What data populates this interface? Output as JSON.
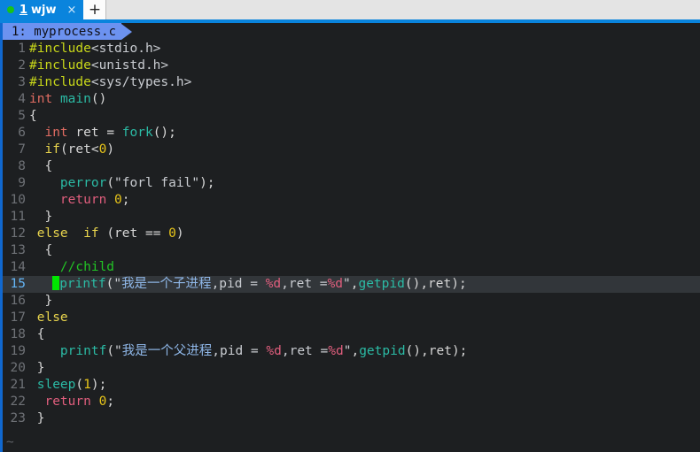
{
  "tabbar": {
    "tab": {
      "status_dot": "green-dot-icon",
      "number": "1",
      "title": "wjw",
      "close_glyph": "×"
    },
    "new_tab_glyph": "+",
    "colors": {
      "active_tab_bg": "#0a84dd",
      "bar_bg": "#e4e4e4",
      "dot": "#19c319"
    }
  },
  "winbar": {
    "crumb": "1: myprocess.c",
    "crumb_bg": "#6c92f0"
  },
  "editor": {
    "filename": "myprocess.c",
    "background": "#1d1f21",
    "current_line": 15,
    "cursor_color": "#00e600",
    "current_line_bg": "#32363a",
    "empty_marker": "~",
    "lines": [
      {
        "n": "1",
        "tokens": [
          {
            "t": "#include",
            "c": "t-pre"
          },
          {
            "t": "<stdio.h>",
            "c": "t-hdr"
          }
        ]
      },
      {
        "n": "2",
        "tokens": [
          {
            "t": "#include",
            "c": "t-pre"
          },
          {
            "t": "<unistd.h>",
            "c": "t-hdr"
          }
        ]
      },
      {
        "n": "3",
        "tokens": [
          {
            "t": "#include",
            "c": "t-pre"
          },
          {
            "t": "<sys/types.h>",
            "c": "t-hdr"
          }
        ]
      },
      {
        "n": "4",
        "tokens": [
          {
            "t": "int",
            "c": "t-type"
          },
          {
            "t": " ",
            "c": "t-plain"
          },
          {
            "t": "main",
            "c": "t-fn"
          },
          {
            "t": "()",
            "c": "t-plain"
          }
        ]
      },
      {
        "n": "5",
        "tokens": [
          {
            "t": "{",
            "c": "t-plain"
          }
        ]
      },
      {
        "n": "6",
        "tokens": [
          {
            "t": "  ",
            "c": "t-plain"
          },
          {
            "t": "int",
            "c": "t-type"
          },
          {
            "t": " ret = ",
            "c": "t-plain"
          },
          {
            "t": "fork",
            "c": "t-fn"
          },
          {
            "t": "();",
            "c": "t-plain"
          }
        ]
      },
      {
        "n": "7",
        "tokens": [
          {
            "t": "  ",
            "c": "t-plain"
          },
          {
            "t": "if",
            "c": "t-kw"
          },
          {
            "t": "(ret<",
            "c": "t-plain"
          },
          {
            "t": "0",
            "c": "t-num"
          },
          {
            "t": ")",
            "c": "t-plain"
          }
        ]
      },
      {
        "n": "8",
        "tokens": [
          {
            "t": "  {",
            "c": "t-plain"
          }
        ]
      },
      {
        "n": "9",
        "tokens": [
          {
            "t": "    ",
            "c": "t-plain"
          },
          {
            "t": "perror",
            "c": "t-fn"
          },
          {
            "t": "(",
            "c": "t-plain"
          },
          {
            "t": "\"forl fail\"",
            "c": "t-str"
          },
          {
            "t": ");",
            "c": "t-plain"
          }
        ]
      },
      {
        "n": "10",
        "tokens": [
          {
            "t": "    ",
            "c": "t-plain"
          },
          {
            "t": "return",
            "c": "t-ret"
          },
          {
            "t": " ",
            "c": "t-plain"
          },
          {
            "t": "0",
            "c": "t-num"
          },
          {
            "t": ";",
            "c": "t-plain"
          }
        ]
      },
      {
        "n": "11",
        "tokens": [
          {
            "t": "  }",
            "c": "t-plain"
          }
        ]
      },
      {
        "n": "12",
        "tokens": [
          {
            "t": " ",
            "c": "t-plain"
          },
          {
            "t": "else",
            "c": "t-kw"
          },
          {
            "t": "  ",
            "c": "t-plain"
          },
          {
            "t": "if",
            "c": "t-kw"
          },
          {
            "t": " (ret == ",
            "c": "t-plain"
          },
          {
            "t": "0",
            "c": "t-num"
          },
          {
            "t": ")",
            "c": "t-plain"
          }
        ]
      },
      {
        "n": "13",
        "tokens": [
          {
            "t": "  {",
            "c": "t-plain"
          }
        ]
      },
      {
        "n": "14",
        "tokens": [
          {
            "t": "    ",
            "c": "t-plain"
          },
          {
            "t": "//child",
            "c": "t-cmt"
          }
        ]
      },
      {
        "n": "15",
        "current": true,
        "cursor_at": 1,
        "tokens": [
          {
            "t": "   ",
            "c": "t-plain"
          },
          {
            "t": "printf",
            "c": "t-fn"
          },
          {
            "t": "(",
            "c": "t-plain"
          },
          {
            "t": "\"",
            "c": "t-str"
          },
          {
            "t": "我是一个子进程",
            "c": "t-cjk"
          },
          {
            "t": ",pid = ",
            "c": "t-str"
          },
          {
            "t": "%d",
            "c": "t-fmt"
          },
          {
            "t": ",ret =",
            "c": "t-str"
          },
          {
            "t": "%d",
            "c": "t-fmt"
          },
          {
            "t": "\"",
            "c": "t-str"
          },
          {
            "t": ",",
            "c": "t-plain"
          },
          {
            "t": "getpid",
            "c": "t-fn"
          },
          {
            "t": "(),ret);",
            "c": "t-plain"
          }
        ]
      },
      {
        "n": "16",
        "tokens": [
          {
            "t": "  }",
            "c": "t-plain"
          }
        ]
      },
      {
        "n": "17",
        "tokens": [
          {
            "t": " ",
            "c": "t-plain"
          },
          {
            "t": "else",
            "c": "t-kw"
          }
        ]
      },
      {
        "n": "18",
        "tokens": [
          {
            "t": " {",
            "c": "t-plain"
          }
        ]
      },
      {
        "n": "19",
        "tokens": [
          {
            "t": "    ",
            "c": "t-plain"
          },
          {
            "t": "printf",
            "c": "t-fn"
          },
          {
            "t": "(",
            "c": "t-plain"
          },
          {
            "t": "\"",
            "c": "t-str"
          },
          {
            "t": "我是一个父进程",
            "c": "t-cjk"
          },
          {
            "t": ",pid = ",
            "c": "t-str"
          },
          {
            "t": "%d",
            "c": "t-fmt"
          },
          {
            "t": ",ret =",
            "c": "t-str"
          },
          {
            "t": "%d",
            "c": "t-fmt"
          },
          {
            "t": "\"",
            "c": "t-str"
          },
          {
            "t": ",",
            "c": "t-plain"
          },
          {
            "t": "getpid",
            "c": "t-fn"
          },
          {
            "t": "(),ret);",
            "c": "t-plain"
          }
        ]
      },
      {
        "n": "20",
        "tokens": [
          {
            "t": " }",
            "c": "t-plain"
          }
        ]
      },
      {
        "n": "21",
        "tokens": [
          {
            "t": " ",
            "c": "t-plain"
          },
          {
            "t": "sleep",
            "c": "t-fn"
          },
          {
            "t": "(",
            "c": "t-plain"
          },
          {
            "t": "1",
            "c": "t-num"
          },
          {
            "t": ");",
            "c": "t-plain"
          }
        ]
      },
      {
        "n": "22",
        "tokens": [
          {
            "t": "  ",
            "c": "t-plain"
          },
          {
            "t": "return",
            "c": "t-ret"
          },
          {
            "t": " ",
            "c": "t-plain"
          },
          {
            "t": "0",
            "c": "t-num"
          },
          {
            "t": ";",
            "c": "t-plain"
          }
        ]
      },
      {
        "n": "23",
        "tokens": [
          {
            "t": " }",
            "c": "t-plain"
          }
        ]
      }
    ]
  }
}
